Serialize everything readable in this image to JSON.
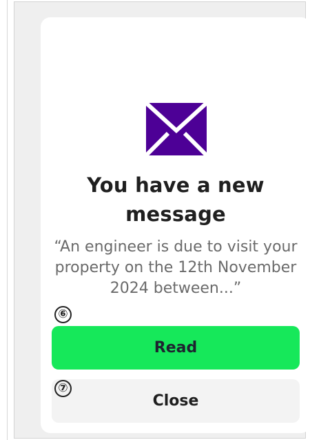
{
  "dialog": {
    "icon_name": "mail-icon",
    "title": "You have a new message",
    "message": "“An engineer is due to visit your property on the 12th November 2024 between...”",
    "annotations": {
      "read": "⑥",
      "close": "⑦"
    },
    "buttons": {
      "read": "Read",
      "close": "Close"
    }
  },
  "colors": {
    "icon": "#4d0096",
    "primary_button": "#16e85a",
    "secondary_button": "#f3f3f3",
    "title_text": "#1f1f1f",
    "body_text": "#6a6a6a"
  }
}
